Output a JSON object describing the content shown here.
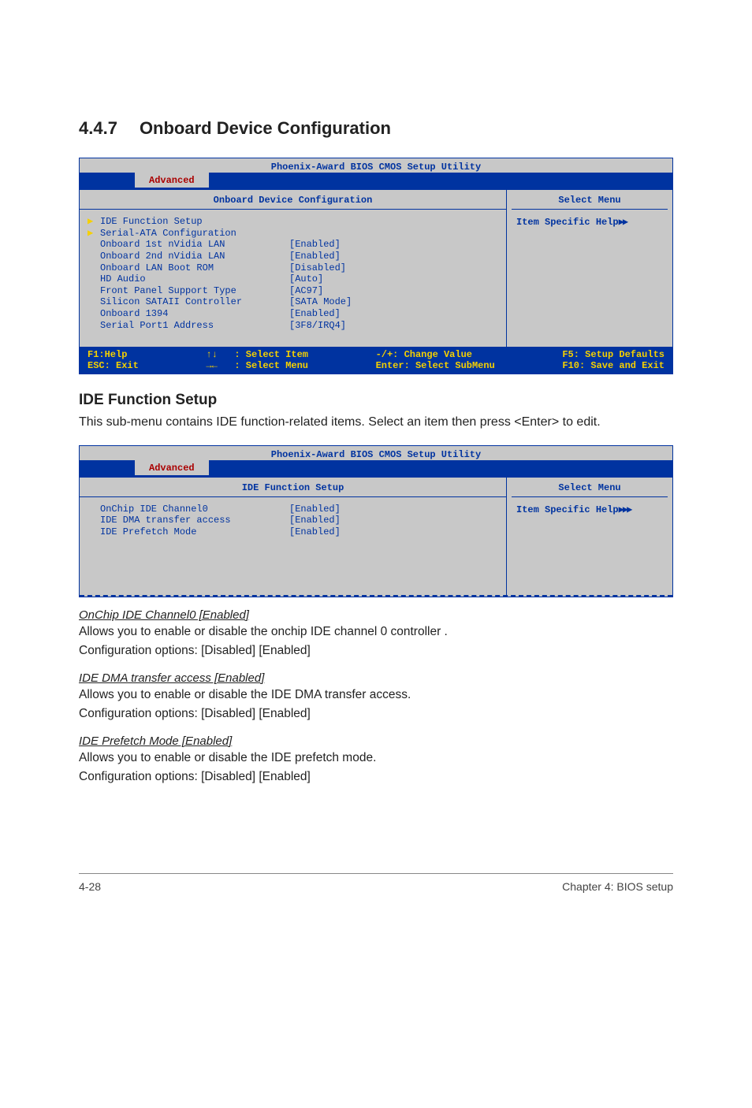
{
  "section": {
    "number": "4.4.7",
    "title": "Onboard Device Configuration"
  },
  "bios1": {
    "utilityTitle": "Phoenix-Award BIOS CMOS Setup Utility",
    "tab": "Advanced",
    "leftTitle": "Onboard Device Configuration",
    "rightTitle": "Select Menu",
    "rightHint": "Item Specific Help",
    "rows": [
      {
        "arrow": "▶",
        "label": "IDE Function Setup",
        "value": ""
      },
      {
        "arrow": "▶",
        "label": "Serial-ATA Configuration",
        "value": ""
      },
      {
        "arrow": "",
        "label": "Onboard 1st nVidia LAN",
        "value": "[Enabled]"
      },
      {
        "arrow": "",
        "label": "Onboard 2nd nVidia LAN",
        "value": "[Enabled]"
      },
      {
        "arrow": "",
        "label": "Onboard LAN Boot ROM",
        "value": "[Disabled]"
      },
      {
        "arrow": "",
        "label": "HD Audio",
        "value": "[Auto]"
      },
      {
        "arrow": "",
        "label": "Front Panel Support Type",
        "value": "[AC97]"
      },
      {
        "arrow": "",
        "label": "Silicon SATAII Controller",
        "value": "[SATA Mode]"
      },
      {
        "arrow": "",
        "label": "Onboard 1394",
        "value": "[Enabled]"
      },
      {
        "arrow": "",
        "label": "Serial Port1 Address",
        "value": "[3F8/IRQ4]"
      }
    ],
    "footer": {
      "c1a": "F1:Help",
      "c1b": "ESC: Exit",
      "c2a": "↑↓   : Select Item",
      "c2b": "→←   : Select Menu",
      "c3a": "-/+: Change Value",
      "c3b": "Enter: Select SubMenu",
      "c4a": "F5: Setup Defaults",
      "c4b": "F10: Save and Exit"
    }
  },
  "subHeading": "IDE Function Setup",
  "subParagraph": "This sub-menu contains IDE function-related items. Select an item then press <Enter> to edit.",
  "bios2": {
    "utilityTitle": "Phoenix-Award BIOS CMOS Setup Utility",
    "tab": "Advanced",
    "leftTitle": "IDE Function Setup",
    "rightTitle": "Select Menu",
    "rightHint": "Item Specific Help",
    "rows": [
      {
        "arrow": "",
        "label": "OnChip IDE Channel0",
        "value": "[Enabled]"
      },
      {
        "arrow": "",
        "label": "IDE DMA transfer access",
        "value": "[Enabled]"
      },
      {
        "arrow": "",
        "label": "IDE Prefetch Mode",
        "value": "[Enabled]"
      }
    ]
  },
  "items": [
    {
      "title": "OnChip IDE Channel0 [Enabled]",
      "line1": "Allows you to enable or disable the onchip IDE channel 0 controller .",
      "line2": "Configuration options: [Disabled] [Enabled]"
    },
    {
      "title": "IDE DMA transfer access [Enabled]",
      "line1": "Allows you to enable or disable the IDE DMA transfer access.",
      "line2": "Configuration options: [Disabled] [Enabled]"
    },
    {
      "title": "IDE Prefetch Mode [Enabled]",
      "line1": "Allows you to enable or disable the IDE prefetch mode.",
      "line2": "Configuration options: [Disabled] [Enabled]"
    }
  ],
  "pageFooter": {
    "left": "4-28",
    "right": "Chapter 4: BIOS setup"
  }
}
